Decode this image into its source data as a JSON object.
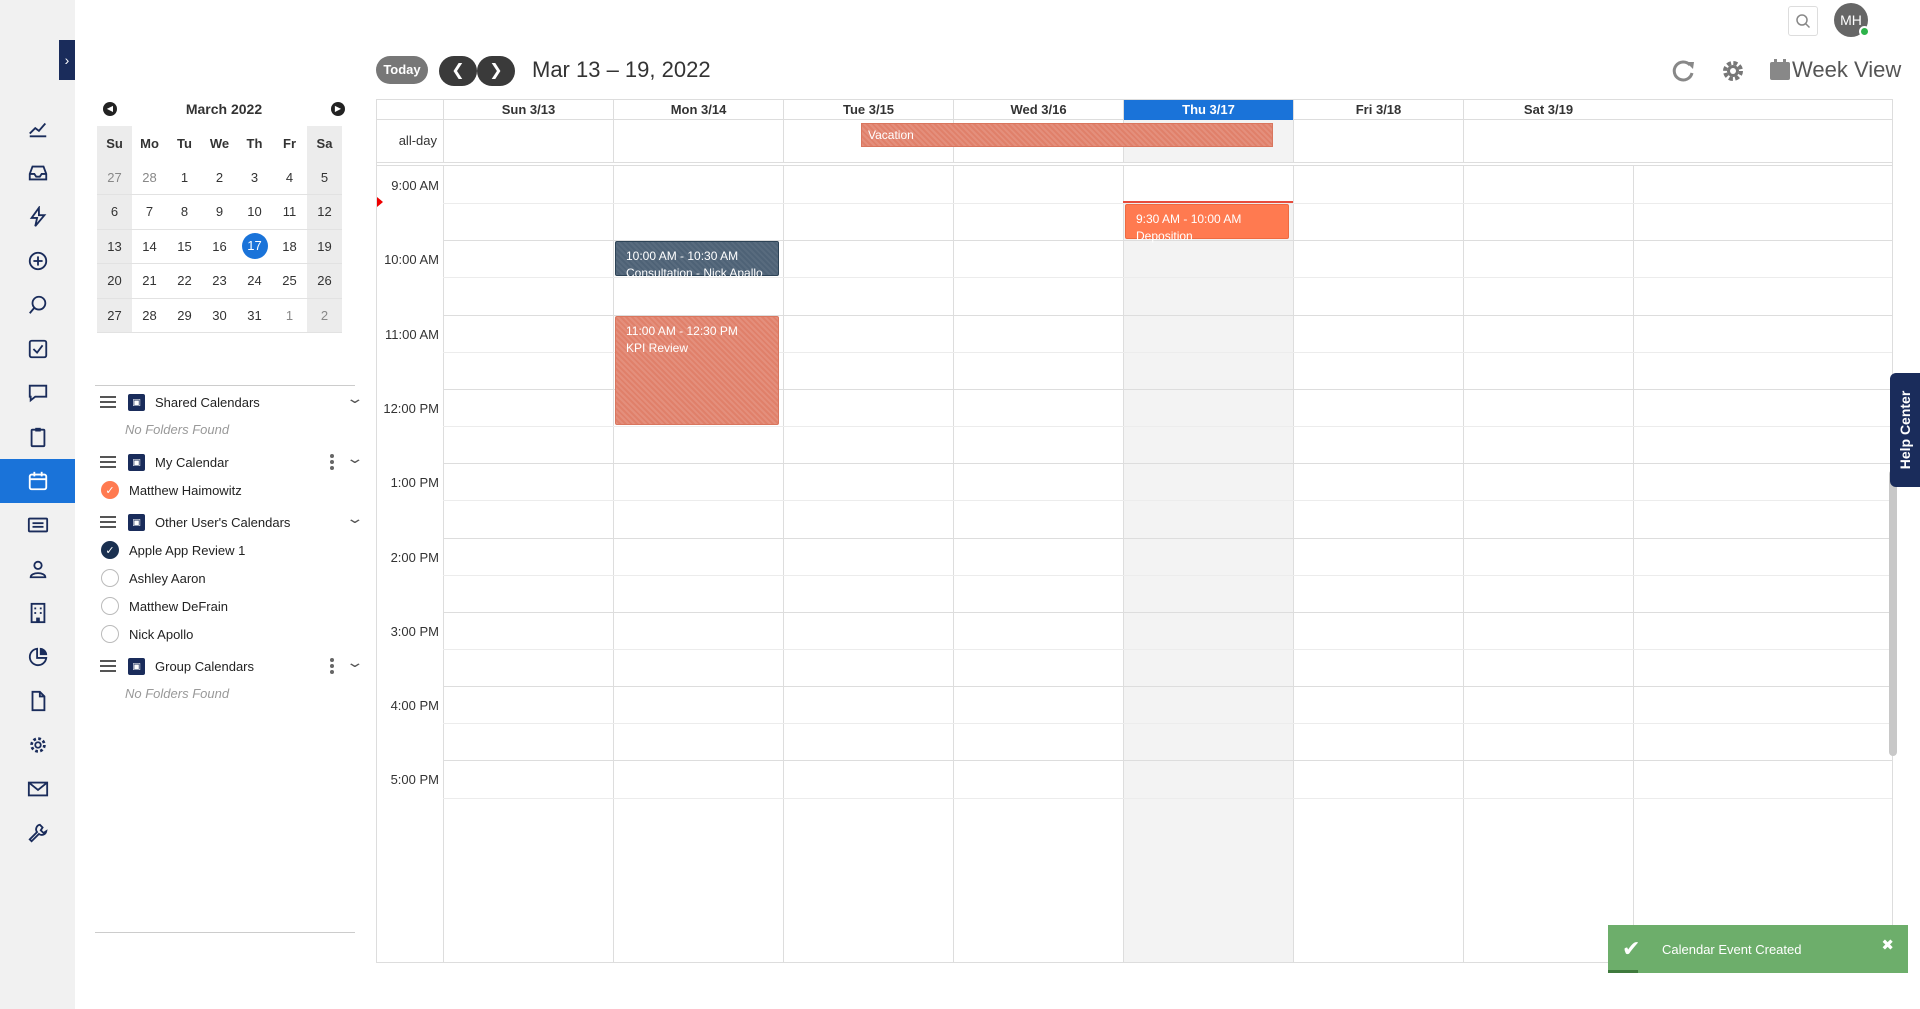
{
  "rail": {
    "items": [
      {
        "icon": "chart-line-icon"
      },
      {
        "icon": "inbox-icon"
      },
      {
        "icon": "lightning-icon"
      },
      {
        "icon": "plus-circle-icon"
      },
      {
        "icon": "search-icon"
      },
      {
        "icon": "checkbox-icon"
      },
      {
        "icon": "chat-icon"
      },
      {
        "icon": "clipboard-icon"
      },
      {
        "icon": "calendar-icon",
        "active": true
      },
      {
        "icon": "id-card-icon"
      },
      {
        "icon": "person-icon"
      },
      {
        "icon": "building-icon"
      },
      {
        "icon": "pie-chart-icon"
      },
      {
        "icon": "document-icon"
      },
      {
        "icon": "gear-icon"
      },
      {
        "icon": "mail-icon"
      },
      {
        "icon": "wrench-icon"
      }
    ]
  },
  "mini_calendar": {
    "title": "March 2022",
    "weekdays": [
      "Su",
      "Mo",
      "Tu",
      "We",
      "Th",
      "Fr",
      "Sa"
    ],
    "weeks": [
      [
        "27",
        "28",
        "1",
        "2",
        "3",
        "4",
        "5"
      ],
      [
        "6",
        "7",
        "8",
        "9",
        "10",
        "11",
        "12"
      ],
      [
        "13",
        "14",
        "15",
        "16",
        "17",
        "18",
        "19"
      ],
      [
        "20",
        "21",
        "22",
        "23",
        "24",
        "25",
        "26"
      ],
      [
        "27",
        "28",
        "29",
        "30",
        "31",
        "1",
        "2"
      ]
    ],
    "selected_day": "17"
  },
  "folders": {
    "shared": {
      "title": "Shared Calendars",
      "empty": "No Folders Found"
    },
    "my": {
      "title": "My Calendar",
      "entries": [
        {
          "name": "Matthew Haimowitz",
          "checked": true
        }
      ]
    },
    "other": {
      "title": "Other User's Calendars",
      "entries": [
        {
          "name": "Apple App Review 1",
          "checked": true
        },
        {
          "name": "Ashley Aaron",
          "checked": false
        },
        {
          "name": "Matthew DeFrain",
          "checked": false
        },
        {
          "name": "Nick Apollo",
          "checked": false
        }
      ]
    },
    "group": {
      "title": "Group Calendars",
      "empty": "No Folders Found"
    }
  },
  "topbar": {
    "avatar_initials": "MH"
  },
  "toolbar": {
    "today_label": "Today",
    "range_title": "Mar 13 – 19, 2022",
    "view_label": "Week View"
  },
  "calendar": {
    "days": [
      "Sun 3/13",
      "Mon 3/14",
      "Tue 3/15",
      "Wed 3/16",
      "Thu 3/17",
      "Fri 3/18",
      "Sat 3/19"
    ],
    "today_index": 4,
    "allday_label": "all-day",
    "times": [
      "9:00 AM",
      "10:00 AM",
      "11:00 AM",
      "12:00 PM",
      "1:00 PM",
      "2:00 PM",
      "3:00 PM",
      "4:00 PM",
      "5:00 PM"
    ],
    "events": {
      "vacation": {
        "title": "Vacation"
      },
      "deposition": {
        "time": "9:30 AM - 10:00 AM",
        "title": "Deposition"
      },
      "consultation": {
        "time": "10:00 AM - 10:30 AM",
        "title": "Consultation - Nick Apallo"
      },
      "kpi": {
        "time": "11:00 AM - 12:30 PM",
        "title": "KPI Review"
      }
    }
  },
  "help_center": {
    "label": "Help Center"
  },
  "toast": {
    "message": "Calendar Event Created",
    "close": "✖"
  },
  "colors": {
    "accent": "#1a73d9",
    "navy": "#1a2c5b",
    "event_orange": "#ff7a50",
    "event_salmon": "#e0806a",
    "event_slate": "#4e6276",
    "toast_green": "#6dae6b"
  }
}
